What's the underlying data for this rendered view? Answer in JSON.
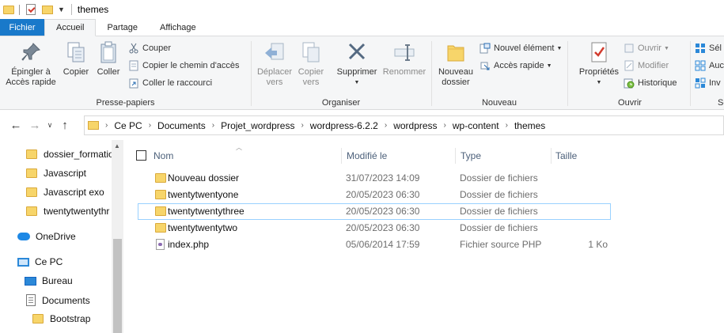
{
  "window": {
    "title": "themes"
  },
  "tabs": [
    {
      "label": "Fichier"
    },
    {
      "label": "Accueil"
    },
    {
      "label": "Partage"
    },
    {
      "label": "Affichage"
    }
  ],
  "ribbon": {
    "clipboard": {
      "label": "Presse-papiers",
      "pin": "Épingler à\nAccès rapide",
      "copy": "Copier",
      "paste": "Coller",
      "cut": "Couper",
      "copy_path": "Copier le chemin d'accès",
      "paste_shortcut": "Coller le raccourci"
    },
    "organize": {
      "label": "Organiser",
      "move_to": "Déplacer\nvers",
      "copy_to": "Copier\nvers",
      "delete": "Supprimer",
      "rename": "Renommer"
    },
    "new": {
      "label": "Nouveau",
      "new_folder": "Nouveau\ndossier",
      "new_item": "Nouvel élément",
      "easy_access": "Accès rapide"
    },
    "open": {
      "label": "Ouvrir",
      "properties": "Propriétés",
      "open": "Ouvrir",
      "edit": "Modifier",
      "history": "Historique"
    },
    "select": {
      "label": "Sé",
      "select_all": "Sél",
      "select_none": "Auc",
      "invert": "Inv"
    }
  },
  "address": {
    "breadcrumbs": [
      "Ce PC",
      "Documents",
      "Projet_wordpress",
      "wordpress-6.2.2",
      "wordpress",
      "wp-content",
      "themes"
    ]
  },
  "sidebar": {
    "items": [
      {
        "label": "dossier_formatio",
        "icon": "folder-icon"
      },
      {
        "label": "Javascript",
        "icon": "folder-icon"
      },
      {
        "label": "Javascript exo",
        "icon": "folder-icon"
      },
      {
        "label": "twentytwentythr",
        "icon": "folder-icon"
      },
      {
        "label": "OneDrive",
        "icon": "onedrive-icon"
      },
      {
        "label": "Ce PC",
        "icon": "pc-icon"
      },
      {
        "label": "Bureau",
        "icon": "desktop-icon"
      },
      {
        "label": "Documents",
        "icon": "documents-icon"
      },
      {
        "label": "Bootstrap",
        "icon": "folder-icon"
      }
    ]
  },
  "filelist": {
    "columns": {
      "name": "Nom",
      "modified": "Modifié le",
      "type": "Type",
      "size": "Taille"
    },
    "rows": [
      {
        "name": "Nouveau dossier",
        "modified": "31/07/2023 14:09",
        "type": "Dossier de fichiers",
        "size": "",
        "icon": "folder-icon"
      },
      {
        "name": "twentytwentyone",
        "modified": "20/05/2023 06:30",
        "type": "Dossier de fichiers",
        "size": "",
        "icon": "folder-icon"
      },
      {
        "name": "twentytwentythree",
        "modified": "20/05/2023 06:30",
        "type": "Dossier de fichiers",
        "size": "",
        "icon": "folder-icon"
      },
      {
        "name": "twentytwentytwo",
        "modified": "20/05/2023 06:30",
        "type": "Dossier de fichiers",
        "size": "",
        "icon": "folder-icon"
      },
      {
        "name": "index.php",
        "modified": "05/06/2014 17:59",
        "type": "Fichier source PHP",
        "size": "1 Ko",
        "icon": "php-file-icon"
      }
    ],
    "focused_row": "twentytwentythree"
  },
  "colors": {
    "accent": "#1979ca",
    "focus_border": "#99d1ff",
    "header_text": "#4c607a"
  }
}
